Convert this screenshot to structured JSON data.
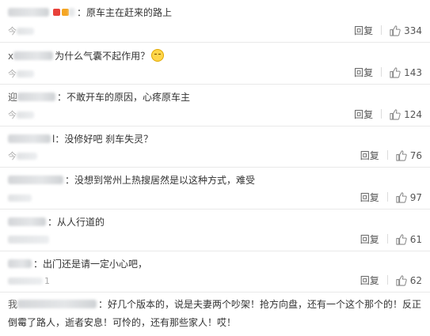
{
  "comments": [
    {
      "prefix": "",
      "text": "：原车主在赶来的路上",
      "meta": "今",
      "reply": "回复",
      "likes": "334"
    },
    {
      "prefix": "x",
      "text": "为什么气囊不起作用？",
      "meta": "今",
      "reply": "回复",
      "likes": "143"
    },
    {
      "prefix": "迎",
      "text": "：不敢开车的原因，心疼原车主",
      "meta": "今",
      "reply": "回复",
      "likes": "124"
    },
    {
      "prefix": "",
      "text": "l：没修好吧 刹车失灵？",
      "meta": "今",
      "reply": "回复",
      "likes": "76"
    },
    {
      "prefix": "",
      "text": "：没想到常州上热搜居然是以这种方式，难受",
      "meta": "",
      "reply": "回复",
      "likes": "97"
    },
    {
      "prefix": "",
      "text": "：从人行道的",
      "meta": "",
      "reply": "回复",
      "likes": "61"
    },
    {
      "prefix": "",
      "text": "：出门还是请一定小心吧，",
      "meta": "1",
      "reply": "回复",
      "likes": "62"
    },
    {
      "prefix": "我",
      "text": "：好几个版本的，说是夫妻两个吵架！抢方向盘，还有一个这个那个的！反正",
      "text2": "倒霉了路人，逝者安息！可怜的，还有那些家人！哎！"
    }
  ]
}
